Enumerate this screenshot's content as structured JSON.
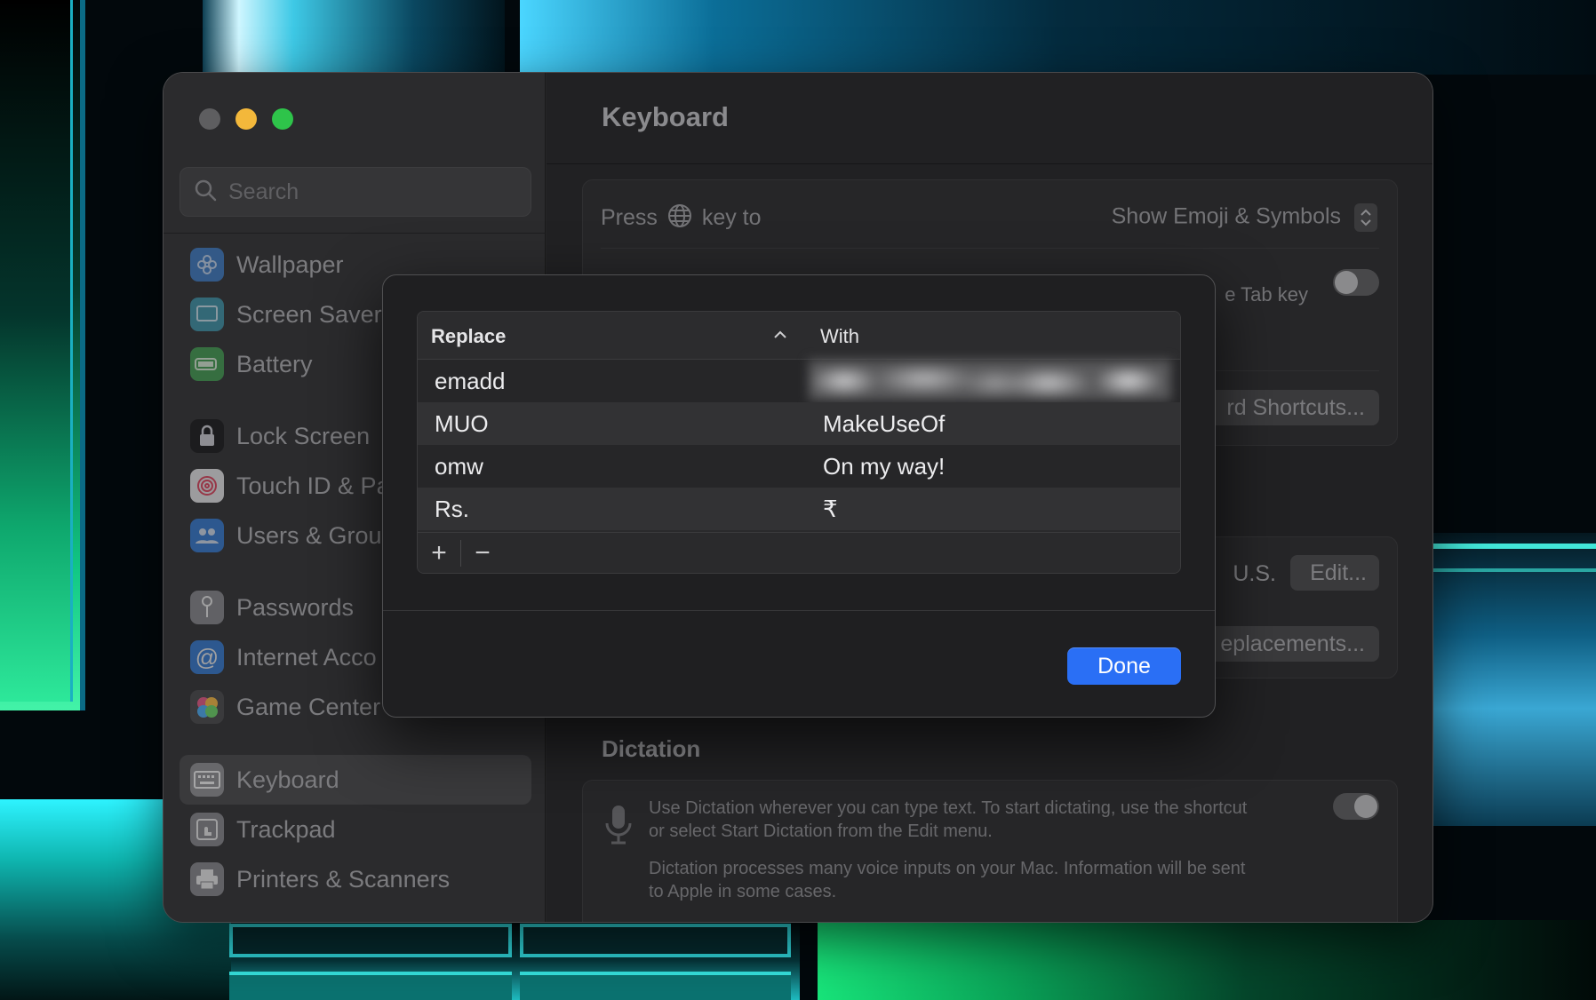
{
  "sidebar": {
    "search_placeholder": "Search",
    "items": [
      {
        "label": "Wallpaper",
        "icon": "wallpaper-icon",
        "color": "#3a7fd1"
      },
      {
        "label": "Screen Saver",
        "icon": "screen-saver-icon",
        "color": "#3a9ab3"
      },
      {
        "label": "Battery",
        "icon": "battery-icon",
        "color": "#3fa650"
      },
      {
        "label": "Lock Screen",
        "icon": "lock-icon",
        "color": "#1c1c1e"
      },
      {
        "label": "Touch ID & Pa",
        "icon": "fingerprint-icon",
        "color": "#e8e8ea"
      },
      {
        "label": "Users & Grou",
        "icon": "users-icon",
        "color": "#2f7de0"
      },
      {
        "label": "Passwords",
        "icon": "key-icon",
        "color": "#8e8e93"
      },
      {
        "label": "Internet Acco",
        "icon": "at-icon",
        "color": "#2f7de0"
      },
      {
        "label": "Game Center",
        "icon": "game-center-icon",
        "color": "#e14b7a"
      },
      {
        "label": "Keyboard",
        "icon": "keyboard-icon",
        "color": "#8e8e93"
      },
      {
        "label": "Trackpad",
        "icon": "trackpad-icon",
        "color": "#8e8e93"
      },
      {
        "label": "Printers & Scanners",
        "icon": "printer-icon",
        "color": "#8e8e93"
      }
    ]
  },
  "content": {
    "title": "Keyboard",
    "press_key_prefix": "Press",
    "press_key_suffix": "key to",
    "press_key_value": "Show Emoji & Symbols",
    "tab_key_text": "e Tab key",
    "shortcuts_button": "rd Shortcuts...",
    "input_source": "U.S.",
    "edit_button": "Edit...",
    "replacements_button": "eplacements...",
    "dictation_title": "Dictation",
    "dictation_text_1": "Use Dictation wherever you can type text. To start dictating, use the shortcut",
    "dictation_text_2": "or select Start Dictation from the Edit menu.",
    "dictation_text_3": "Dictation processes many voice inputs on your Mac. Information will be sent",
    "dictation_text_4": "to Apple in some cases."
  },
  "dialog": {
    "columns": {
      "replace": "Replace",
      "with": "With"
    },
    "rows": [
      {
        "replace": "emadd",
        "with": ""
      },
      {
        "replace": "MUO",
        "with": "MakeUseOf"
      },
      {
        "replace": "omw",
        "with": "On my way!"
      },
      {
        "replace": "Rs.",
        "with": "₹"
      }
    ],
    "add_label": "+",
    "remove_label": "−",
    "done_label": "Done"
  },
  "colors": {
    "accent": "#2a6ff5",
    "close": "#5e5e60",
    "minimize": "#f3b83b",
    "zoom": "#2ec44a"
  }
}
